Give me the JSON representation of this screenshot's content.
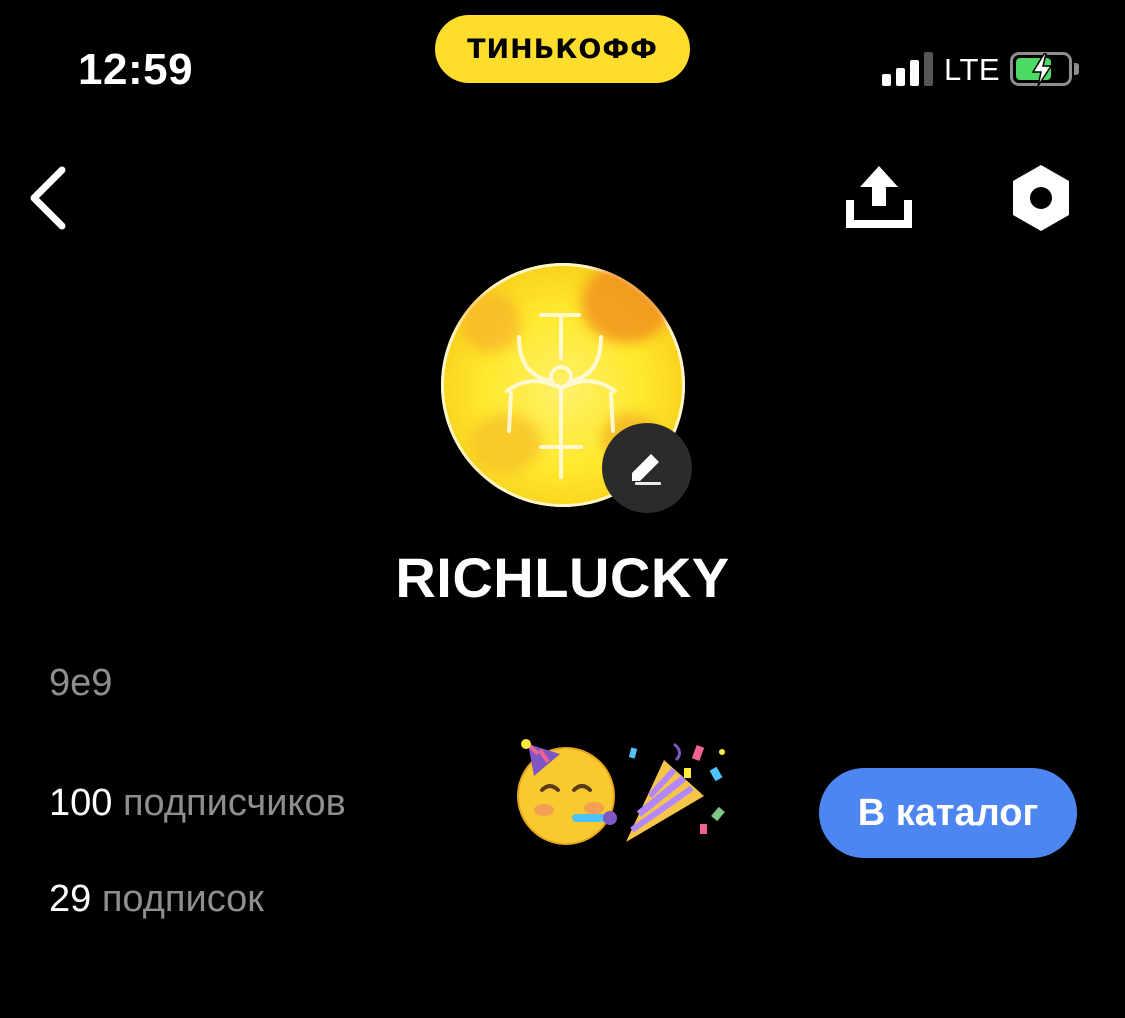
{
  "status_bar": {
    "time": "12:59",
    "carrier_brand": "ТИНЬКОФФ",
    "network": "LTE",
    "battery_level": 0.7,
    "battery_charging": true,
    "signal_bars_active": 3,
    "signal_bars_total": 4
  },
  "nav": {
    "back_icon": "chevron-left-icon",
    "share_icon": "share-upload-icon",
    "settings_icon": "settings-hexagon-icon"
  },
  "profile": {
    "avatar_icon": "rune-emblem-avatar",
    "edit_icon": "pencil-icon",
    "username": "RICHLUCKY",
    "bio": "9e9",
    "followers_count": "100",
    "followers_label": "подписчиков",
    "following_count": "29",
    "following_label": "подписок",
    "celebration_emoji": "🥳🎉",
    "catalog_button_label": "В каталог"
  },
  "colors": {
    "background": "#000000",
    "brand_yellow": "#FFDD2D",
    "accent_blue": "#4D86F0",
    "secondary_text": "#8D8D92",
    "battery_green": "#4CD964",
    "badge_bg": "#2B2B2B"
  }
}
